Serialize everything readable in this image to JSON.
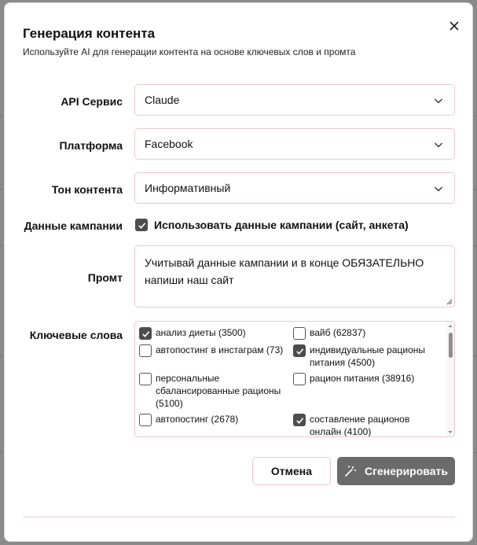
{
  "dialog": {
    "title": "Генерация контента",
    "subtitle": "Используйте AI для генерации контента на основе ключевых слов и промта"
  },
  "fields": {
    "api_service": {
      "label": "API Сервис",
      "value": "Claude"
    },
    "platform": {
      "label": "Платформа",
      "value": "Facebook"
    },
    "tone": {
      "label": "Тон контента",
      "value": "Информативный"
    },
    "campaign": {
      "label": "Данные кампании",
      "checkbox_label": "Использовать данные кампании (сайт, анкета)",
      "checked": true
    },
    "prompt": {
      "label": "Промт",
      "value": "Учитывай данные кампании и в конце ОБЯЗАТЕЛЬНО напиши наш сайт"
    },
    "keywords": {
      "label": "Ключевые слова",
      "items": [
        {
          "label": "анализ диеты (3500)",
          "checked": true
        },
        {
          "label": "вайб (62837)",
          "checked": false
        },
        {
          "label": "автопостинг в инстаграм (73)",
          "checked": false
        },
        {
          "label": "индивидуальные рационы питания (4500)",
          "checked": true
        },
        {
          "label": "персональные сбалансированные рационы (5100)",
          "checked": false
        },
        {
          "label": "рацион питания (38916)",
          "checked": false
        },
        {
          "label": "автопостинг (2678)",
          "checked": false
        },
        {
          "label": "составление рационов онлайн (4100)",
          "checked": true
        }
      ]
    }
  },
  "buttons": {
    "cancel": "Отмена",
    "generate": "Сгенерировать"
  },
  "icons": {
    "close": "close-icon",
    "chevron": "chevron-down-icon",
    "check": "checkmark-icon",
    "wand": "magic-wand-icon"
  },
  "colors": {
    "border_accent": "#f1c7cd",
    "checkbox_on": "#4d4d4d",
    "primary_button": "#6b6b6b"
  }
}
